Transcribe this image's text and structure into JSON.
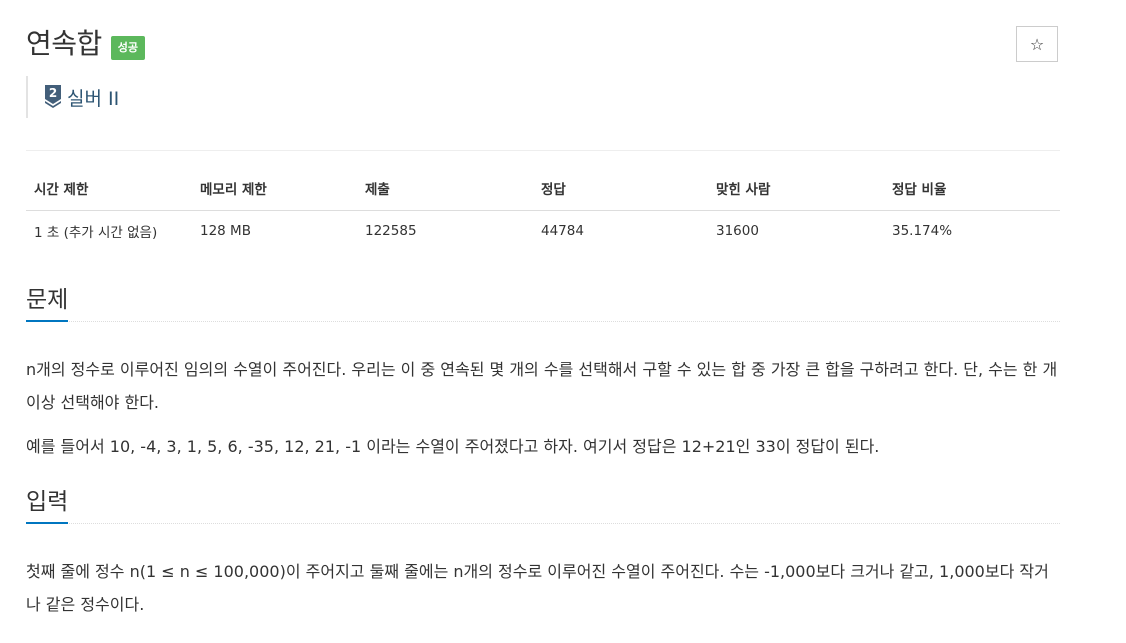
{
  "problem": {
    "title": "연속합",
    "status_badge": "성공",
    "star_glyph": "☆",
    "tier": {
      "number": "2",
      "name": "실버 II",
      "color": "#435f7a"
    }
  },
  "info_table": {
    "headers": [
      "시간 제한",
      "메모리 제한",
      "제출",
      "정답",
      "맞힌 사람",
      "정답 비율"
    ],
    "row": [
      "1 초 (추가 시간 없음)",
      "128 MB",
      "122585",
      "44784",
      "31600",
      "35.174%"
    ]
  },
  "sections": {
    "problem": {
      "heading": "문제",
      "paragraphs": [
        "n개의 정수로 이루어진 임의의 수열이 주어진다. 우리는 이 중 연속된 몇 개의 수를 선택해서 구할 수 있는 합 중 가장 큰 합을 구하려고 한다. 단, 수는 한 개 이상 선택해야 한다.",
        "예를 들어서 10, -4, 3, 1, 5, 6, -35, 12, 21, -1 이라는 수열이 주어졌다고 하자. 여기서 정답은 12+21인 33이 정답이 된다."
      ]
    },
    "input": {
      "heading": "입력",
      "paragraphs": [
        "첫째 줄에 정수 n(1 ≤ n ≤ 100,000)이 주어지고 둘째 줄에는 n개의 정수로 이루어진 수열이 주어진다. 수는 -1,000보다 크거나 같고, 1,000보다 작거나 같은 정수이다."
      ]
    }
  },
  "colors": {
    "success_badge": "#5cb85c",
    "heading_underline": "#0076c0",
    "tier_text": "#2d5573"
  }
}
